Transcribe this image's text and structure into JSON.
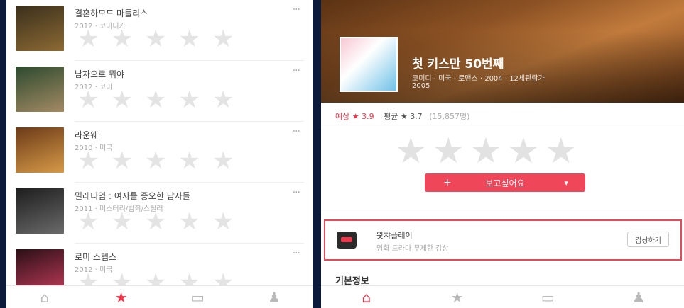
{
  "left": {
    "rows": [
      {
        "title": "결혼하모드 마들리스",
        "meta": "2012 · 코미디가",
        "poster_colors": [
          "#3a2f1c",
          "#8c6a34"
        ]
      },
      {
        "title": "남자으로 뭐야",
        "meta": "2012 · 코미",
        "poster_colors": [
          "#2d4a2f",
          "#a38a63"
        ]
      },
      {
        "title": "라운웨",
        "meta": "2010 · 미국",
        "poster_colors": [
          "#6b3a18",
          "#d79a48"
        ]
      },
      {
        "title": "밀레니엄 : 여자를 증오한 남자들",
        "meta": "2011 · 미스터리/범죄/스릴러",
        "poster_colors": [
          "#1d1d1d",
          "#6a6a6a"
        ]
      },
      {
        "title": "로미 스텝스",
        "meta": "2012 · 미국",
        "poster_colors": [
          "#2a0f16",
          "#c23c5a"
        ]
      }
    ],
    "more_icon": "more-dots-icon",
    "tabs": [
      {
        "icon": "home-icon",
        "glyph": "⌂",
        "active": false
      },
      {
        "icon": "star-icon",
        "glyph": "★",
        "active": true
      },
      {
        "icon": "chat-icon",
        "glyph": "▭",
        "active": false
      },
      {
        "icon": "user-icon",
        "glyph": "♟",
        "active": false
      }
    ]
  },
  "right": {
    "hero": {
      "title": "첫 키스만 50번째",
      "subtitle": "코미디 · 미국 · 로맨스 · 2004 · 12세관람가",
      "subtitle2": "2005"
    },
    "rating": {
      "expected": "예상 ★ 3.9",
      "average": "평균 ★ 3.7",
      "count": "(15,857명)"
    },
    "want_button": {
      "label": "보고싶어요",
      "plus": "+",
      "chevron": "▾"
    },
    "watcha": {
      "name": "왓챠플레이",
      "desc": "영화 드라마 무제한 감상",
      "button": "감상하기"
    },
    "section_title": "기본정보",
    "tabs": [
      {
        "icon": "home-icon",
        "glyph": "⌂",
        "active": true
      },
      {
        "icon": "star-icon",
        "glyph": "★",
        "active": false
      },
      {
        "icon": "chat-icon",
        "glyph": "▭",
        "active": false
      },
      {
        "icon": "user-icon",
        "glyph": "♟",
        "active": false
      }
    ]
  },
  "colors": {
    "accent": "#f0374b",
    "background": "#0b1a3a",
    "highlight_border": "#e34b5b"
  }
}
